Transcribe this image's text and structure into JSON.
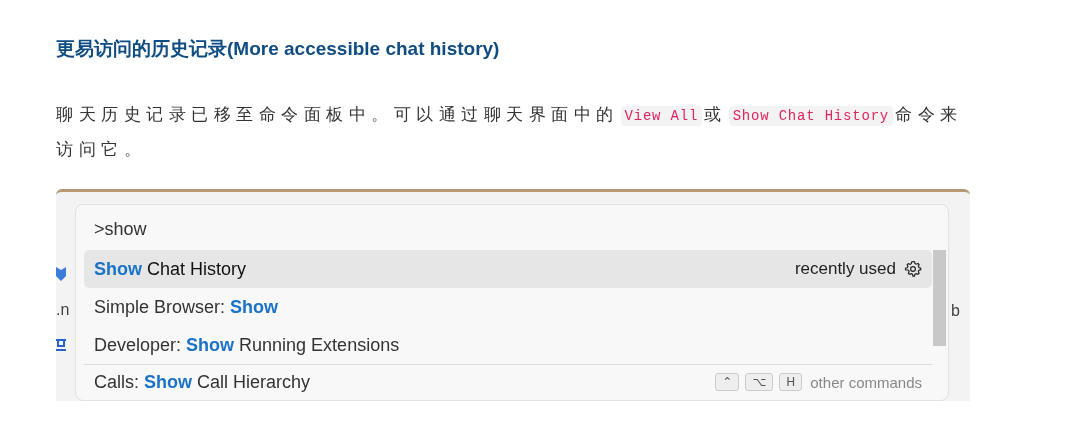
{
  "article": {
    "heading": "更易访问的历史记录(More accessible chat history)",
    "paragraph": [
      {
        "kind": "text",
        "text": "聊天历史记录已移至命令面板中。可以通过聊天界面中的"
      },
      {
        "kind": "code",
        "text": "View All"
      },
      {
        "kind": "text",
        "text": "或"
      },
      {
        "kind": "code",
        "text": "Show Chat History"
      },
      {
        "kind": "text",
        "text": "命令来访问它。"
      }
    ]
  },
  "screenshot": {
    "left_fragments": [
      ".n"
    ],
    "right_fragments": [
      "b"
    ],
    "palette": {
      "query": ">show",
      "items": [
        {
          "selected": true,
          "label": "**Show** Chat History",
          "detail": "recently used"
        },
        {
          "selected": false,
          "label": "Simple Browser: **Show**"
        },
        {
          "selected": false,
          "label": "Developer: **Show** Running Extensions"
        },
        {
          "selected": false,
          "label": "Calls: **Show** Call Hierarchy",
          "keys": [
            "⌃",
            "⌥",
            "H"
          ],
          "detail": "other commands"
        }
      ]
    }
  }
}
